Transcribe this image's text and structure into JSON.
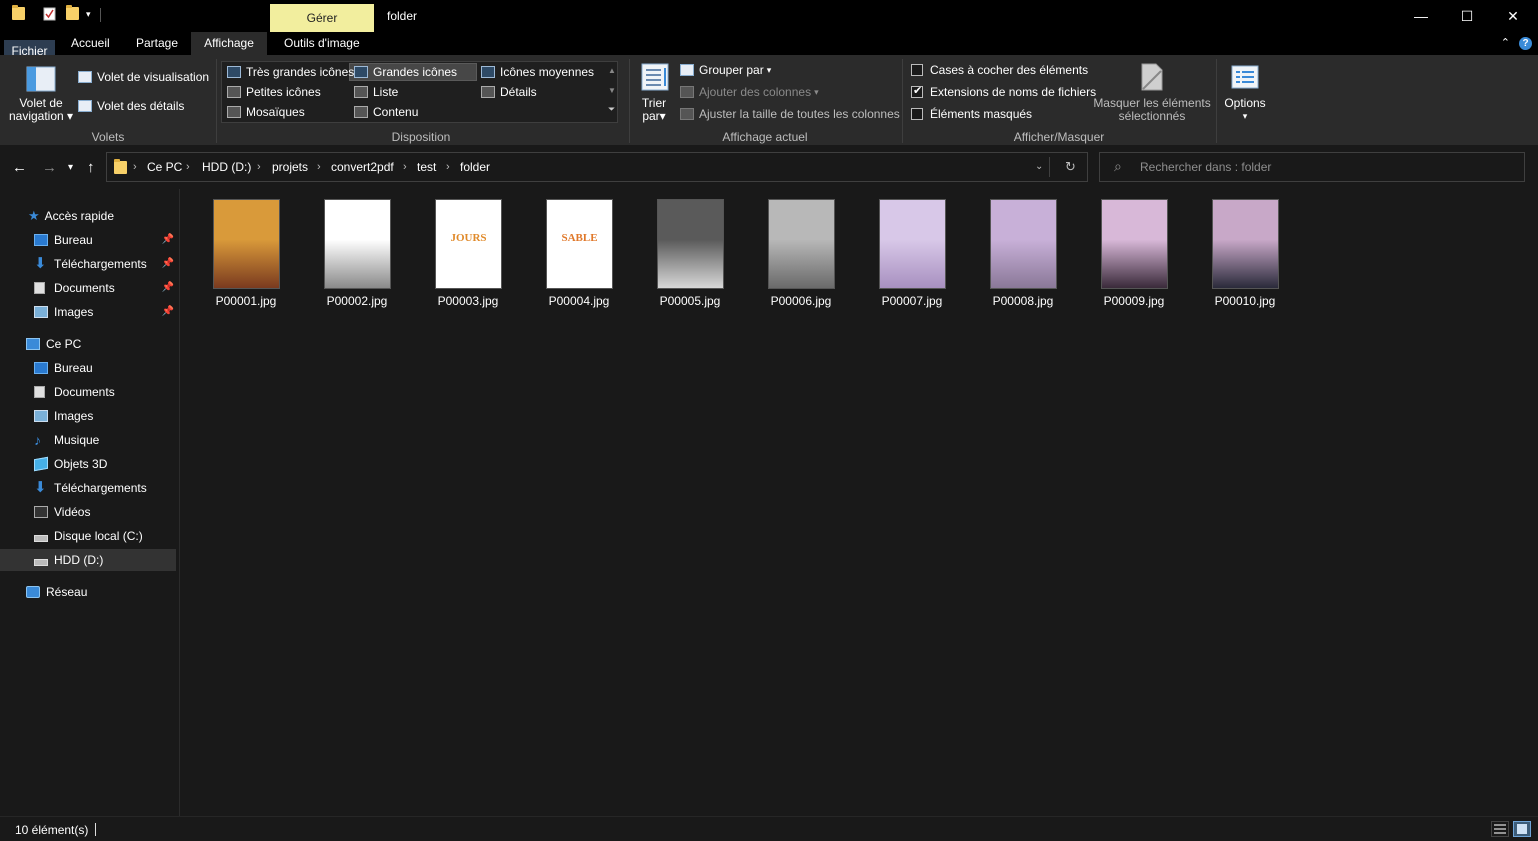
{
  "window": {
    "title": "folder",
    "context_tab": "Gérer",
    "minimize": "—",
    "maximize": "☐",
    "close": "✕"
  },
  "tabs": [
    {
      "label": "Fichier"
    },
    {
      "label": "Accueil"
    },
    {
      "label": "Partage"
    },
    {
      "label": "Affichage"
    },
    {
      "label": "Outils d'image"
    }
  ],
  "ribbon": {
    "volets": {
      "group": "Volets",
      "nav_pane_line1": "Volet de",
      "nav_pane_line2": "navigation",
      "preview_pane": "Volet de visualisation",
      "details_pane": "Volet des détails"
    },
    "disposition": {
      "group": "Disposition",
      "items": [
        "Très grandes icônes",
        "Grandes icônes",
        "Icônes moyennes",
        "Petites icônes",
        "Liste",
        "Détails",
        "Mosaïques",
        "Contenu"
      ],
      "selected": "Grandes icônes"
    },
    "affichage_actuel": {
      "group": "Affichage actuel",
      "sort_line1": "Trier",
      "sort_line2": "par",
      "group_by": "Grouper par",
      "add_columns": "Ajouter des colonnes",
      "fit_columns": "Ajuster la taille de toutes les colonnes"
    },
    "afficher_masquer": {
      "group": "Afficher/Masquer",
      "checkboxes": [
        {
          "label": "Cases à cocher des éléments",
          "checked": false
        },
        {
          "label": "Extensions de noms de fichiers",
          "checked": true
        },
        {
          "label": "Éléments masqués",
          "checked": false
        }
      ],
      "hide_selected_line1": "Masquer les éléments",
      "hide_selected_line2": "sélectionnés"
    },
    "options": "Options"
  },
  "address": {
    "breadcrumbs": [
      "Ce PC",
      "HDD (D:)",
      "projets",
      "convert2pdf",
      "test",
      "folder"
    ],
    "search_placeholder": "Rechercher dans : folder"
  },
  "sidebar": {
    "quick_access": {
      "label": "Accès rapide",
      "items": [
        {
          "label": "Bureau",
          "icon": "desktop-icon"
        },
        {
          "label": "Téléchargements",
          "icon": "download-icon"
        },
        {
          "label": "Documents",
          "icon": "document-icon"
        },
        {
          "label": "Images",
          "icon": "images-icon"
        }
      ]
    },
    "this_pc": {
      "label": "Ce PC",
      "items": [
        {
          "label": "Bureau",
          "icon": "desktop-icon"
        },
        {
          "label": "Documents",
          "icon": "document-icon"
        },
        {
          "label": "Images",
          "icon": "images-icon"
        },
        {
          "label": "Musique",
          "icon": "music-icon"
        },
        {
          "label": "Objets 3D",
          "icon": "cube-icon"
        },
        {
          "label": "Téléchargements",
          "icon": "download-icon"
        },
        {
          "label": "Vidéos",
          "icon": "video-icon"
        },
        {
          "label": "Disque local (C:)",
          "icon": "drive-icon"
        },
        {
          "label": "HDD (D:)",
          "icon": "drive-icon"
        }
      ],
      "selected": "HDD (D:)"
    },
    "network": {
      "label": "Réseau"
    }
  },
  "files": [
    {
      "name": "P00001.jpg",
      "thumb_colors": [
        "#d99a3a",
        "#7a3a1f"
      ]
    },
    {
      "name": "P00002.jpg",
      "thumb_colors": [
        "#ffffff",
        "#8a8a8a"
      ]
    },
    {
      "name": "P00003.jpg",
      "thumb_colors": [
        "#ffffff",
        "#e08a2a"
      ],
      "thumb_text": "JOURS"
    },
    {
      "name": "P00004.jpg",
      "thumb_colors": [
        "#ffffff",
        "#e0782a"
      ],
      "thumb_text": "SABLE"
    },
    {
      "name": "P00005.jpg",
      "thumb_colors": [
        "#5a5a5a",
        "#d8d8d8"
      ]
    },
    {
      "name": "P00006.jpg",
      "thumb_colors": [
        "#b8b8b8",
        "#6a6a6a"
      ]
    },
    {
      "name": "P00007.jpg",
      "thumb_colors": [
        "#d8c8e8",
        "#a890c0"
      ]
    },
    {
      "name": "P00008.jpg",
      "thumb_colors": [
        "#c8b0d8",
        "#8a7898"
      ]
    },
    {
      "name": "P00009.jpg",
      "thumb_colors": [
        "#d8b8d8",
        "#3a2a3a"
      ]
    },
    {
      "name": "P00010.jpg",
      "thumb_colors": [
        "#c8a8c8",
        "#2a2a3a"
      ]
    }
  ],
  "status": {
    "count": "10 élément(s)"
  }
}
